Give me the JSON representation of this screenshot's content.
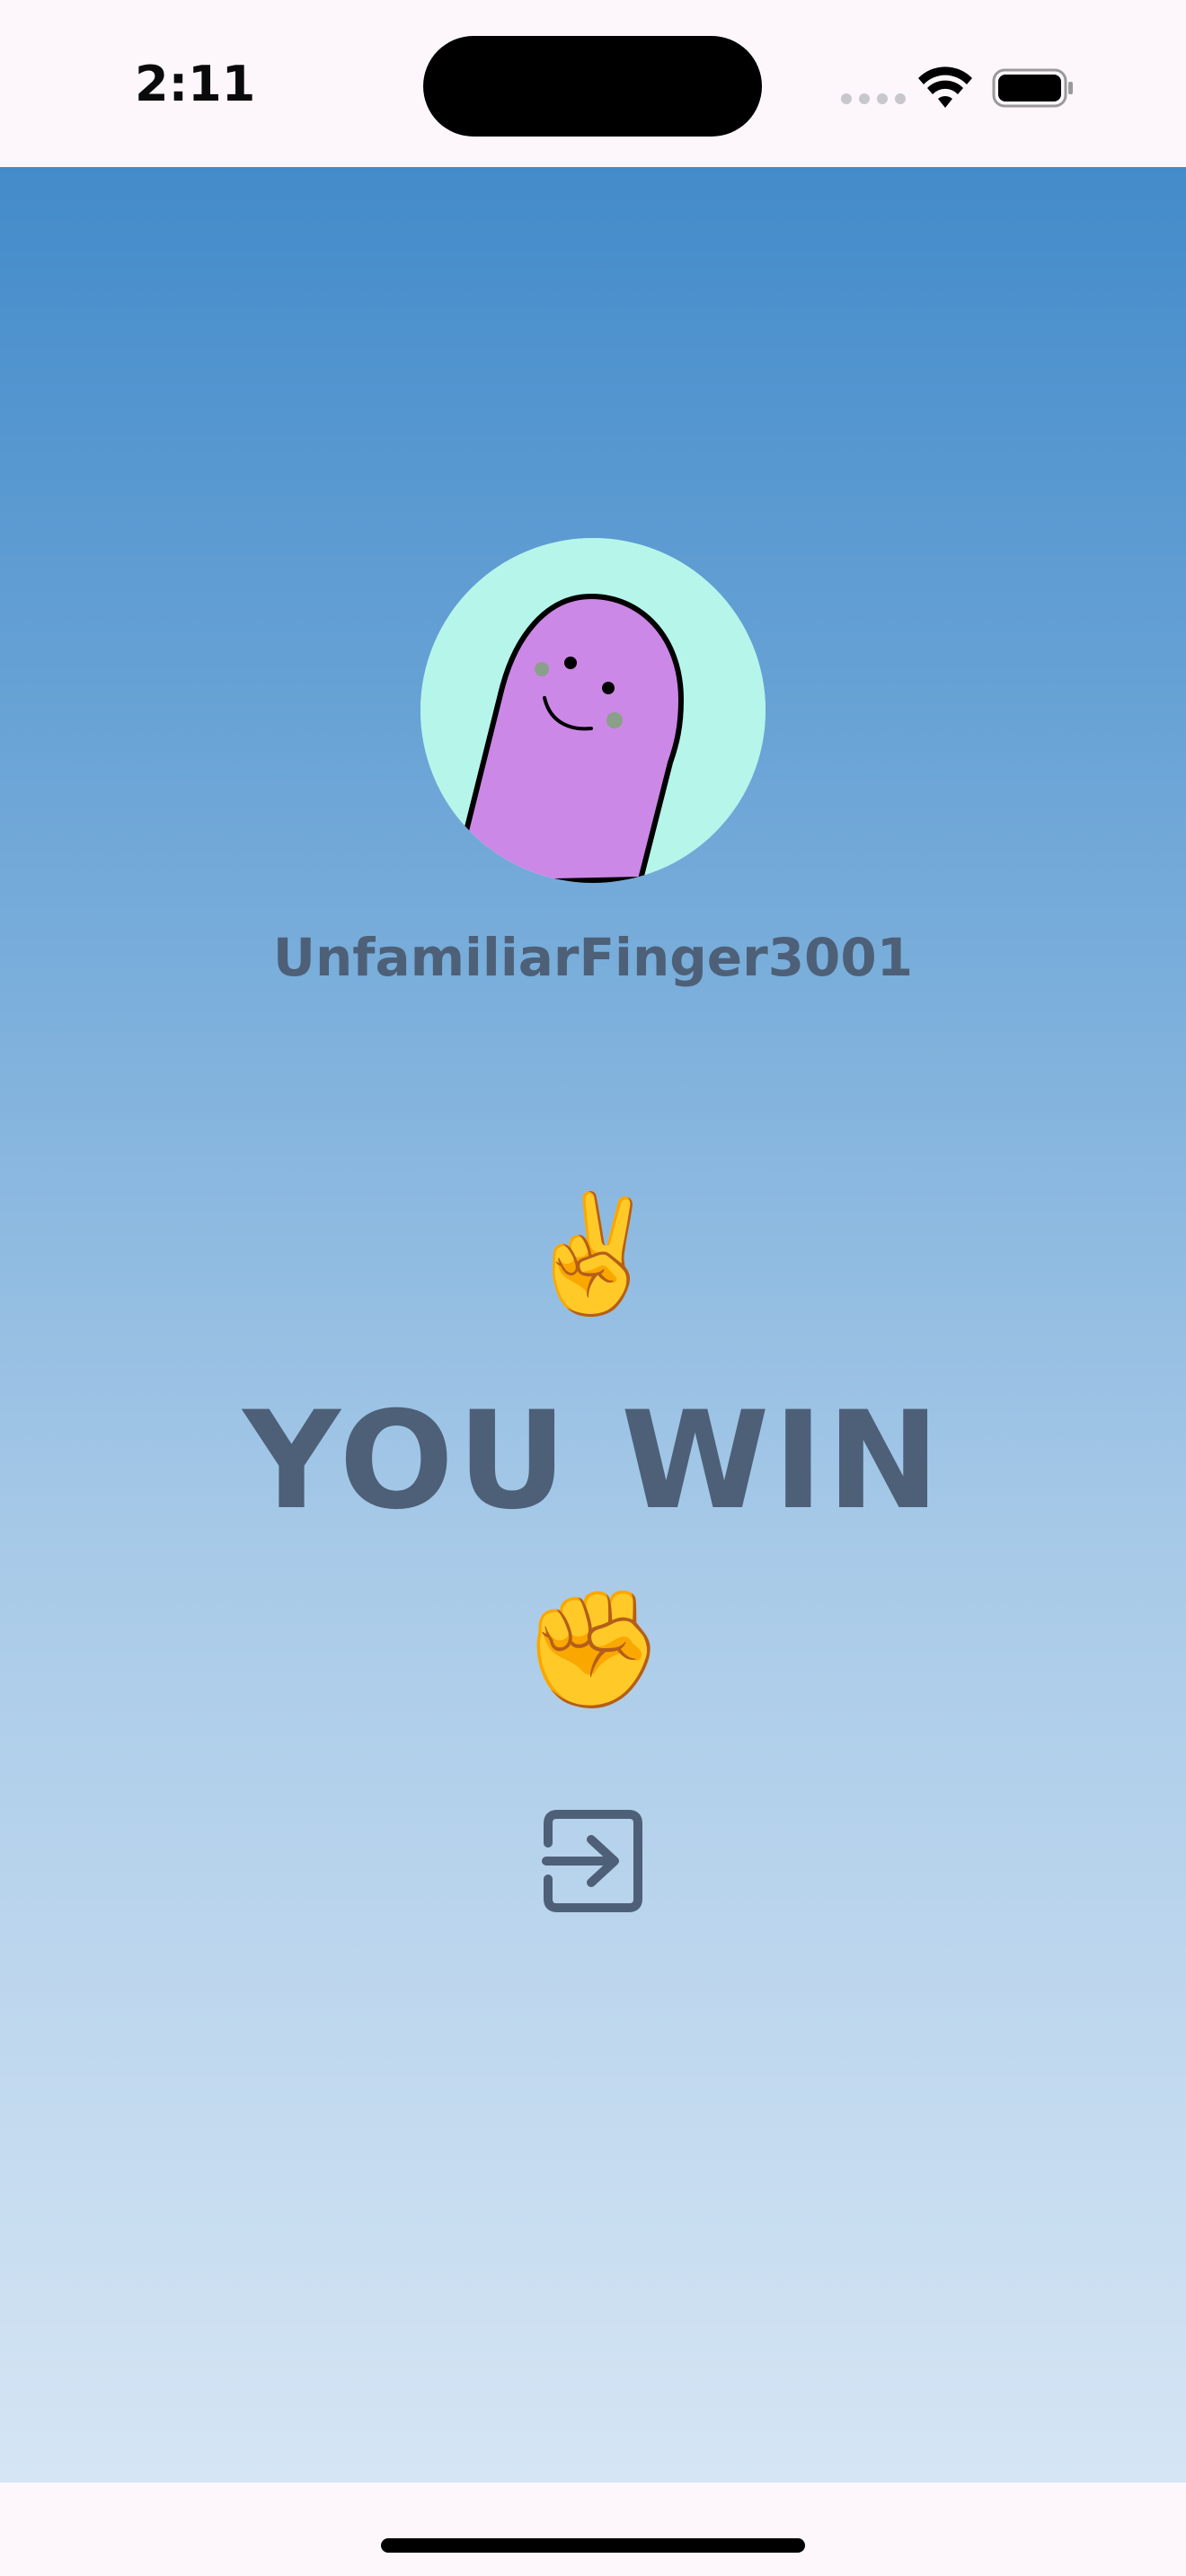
{
  "status_bar": {
    "time": "2:11",
    "icons": [
      "signal-dots-icon",
      "wifi-icon",
      "battery-icon"
    ]
  },
  "game": {
    "username": "UnfamiliarFinger3001",
    "opponent_choice": "✌️",
    "result": "YOU WIN",
    "player_choice": "✊",
    "exit_icon": "exit-icon"
  },
  "colors": {
    "gradient_top": "#438bca",
    "gradient_bottom": "#d5e5f4",
    "text": "#4d6077",
    "avatar_bg": "#b6f5ea",
    "avatar_figure": "#cc88e6"
  }
}
